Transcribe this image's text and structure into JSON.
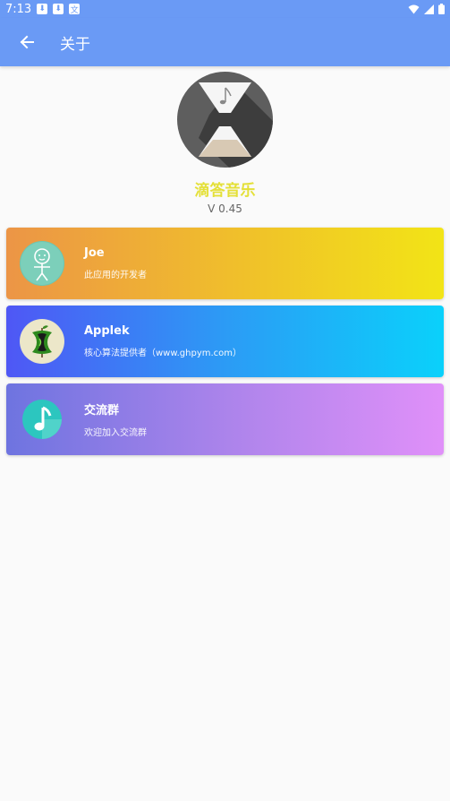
{
  "status_bar": {
    "time": "7:13",
    "notification_icons": [
      "download-icon",
      "download-icon",
      "translate-icon"
    ],
    "system_icons": [
      "wifi-icon",
      "signal-icon",
      "battery-icon"
    ]
  },
  "app_bar": {
    "title": "关于",
    "back_icon": "arrow-left-icon",
    "color": "#6a9af5"
  },
  "app_info": {
    "name": "滴答音乐",
    "version": "V 0.45",
    "name_color": "#e4e038"
  },
  "cards": [
    {
      "name": "Joe",
      "desc": "此应用的开发者",
      "avatar_icon": "stick-figure-icon"
    },
    {
      "name": "Applek",
      "desc": "核心算法提供者（www.ghpym.com）",
      "avatar_icon": "apple-core-icon"
    },
    {
      "name": "交流群",
      "desc": "欢迎加入交流群",
      "avatar_icon": "music-note-icon"
    }
  ]
}
